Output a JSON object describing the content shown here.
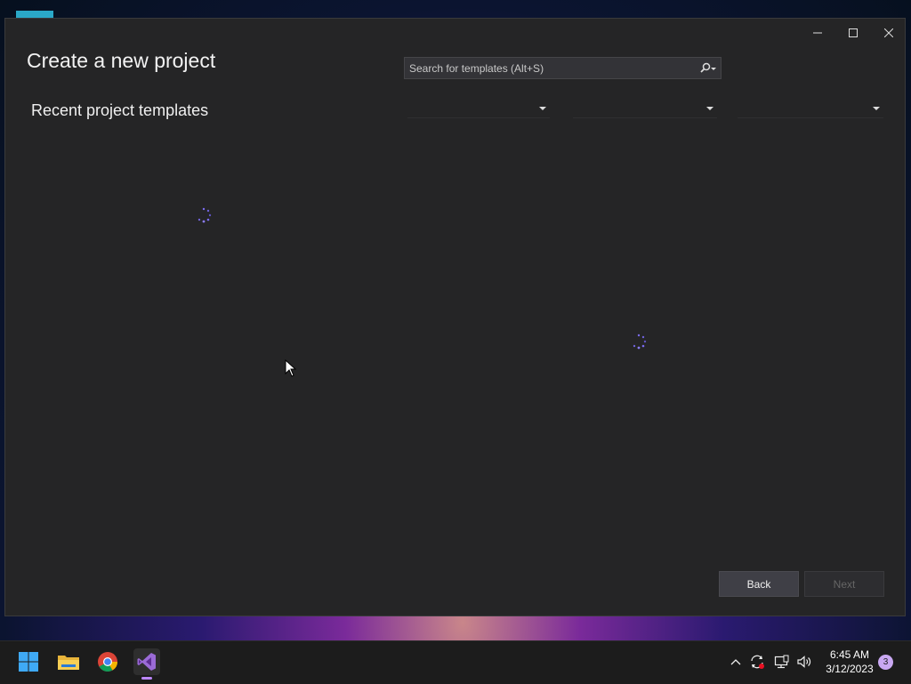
{
  "window": {
    "title": "Create a new project",
    "subtitle": "Recent project templates",
    "controls": [
      "minimize-icon",
      "maximize-icon",
      "close-icon"
    ]
  },
  "search": {
    "placeholder": "Search for templates (Alt+S)",
    "value": ""
  },
  "filters": [
    {
      "name": "language-filter",
      "selected": ""
    },
    {
      "name": "platform-filter",
      "selected": ""
    },
    {
      "name": "project-type-filter",
      "selected": ""
    }
  ],
  "loading": {
    "recent_templates": true,
    "template_list": true
  },
  "buttons": {
    "back": "Back",
    "next": "Next",
    "next_enabled": false
  },
  "taskbar": {
    "apps": [
      "start-icon",
      "file-explorer-icon",
      "chrome-icon",
      "visual-studio-icon"
    ],
    "active_app": "visual-studio-icon",
    "clock": {
      "time": "6:45 AM",
      "date": "3/12/2023"
    },
    "notification_count": "3"
  },
  "colors": {
    "window_bg": "#252526",
    "accent": "#bb86fc",
    "spinner": "#7b6cf0"
  }
}
